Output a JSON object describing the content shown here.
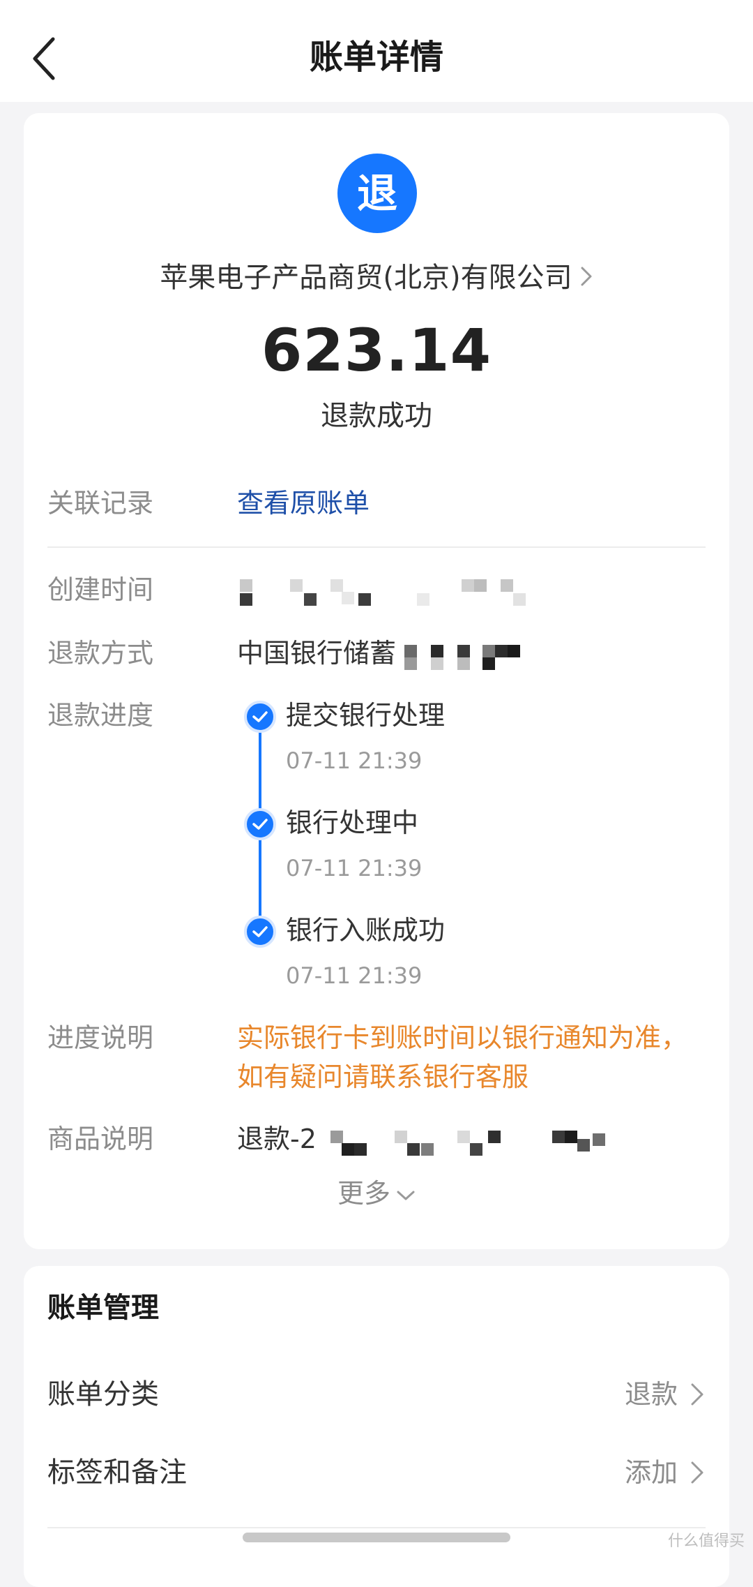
{
  "header": {
    "title": "账单详情"
  },
  "summary": {
    "badge_char": "退",
    "merchant": "苹果电子产品商贸(北京)有限公司",
    "amount": "623.14",
    "status": "退款成功"
  },
  "details": {
    "related_label": "关联记录",
    "related_link": "查看原账单",
    "created_label": "创建时间",
    "method_label": "退款方式",
    "method_value": "中国银行储蓄",
    "progress_label": "退款进度",
    "steps": [
      {
        "title": "提交银行处理",
        "time": "07-11 21:39"
      },
      {
        "title": "银行处理中",
        "time": "07-11 21:39"
      },
      {
        "title": "银行入账成功",
        "time": "07-11 21:39"
      }
    ],
    "note_label": "进度说明",
    "note_line1": "实际银行卡到账时间以银行通知为准，",
    "note_line2": "如有疑问请联系银行客服",
    "goods_label": "商品说明",
    "goods_value": "退款-2",
    "more_label": "更多"
  },
  "management": {
    "title": "账单管理",
    "category_label": "账单分类",
    "category_value": "退款",
    "tags_label": "标签和备注",
    "tags_value": "添加"
  },
  "watermark": "什么值得买",
  "colors": {
    "accent": "#1677ff",
    "link": "#1e4fa8",
    "warning": "#e8872c",
    "background": "#f4f4f6"
  }
}
